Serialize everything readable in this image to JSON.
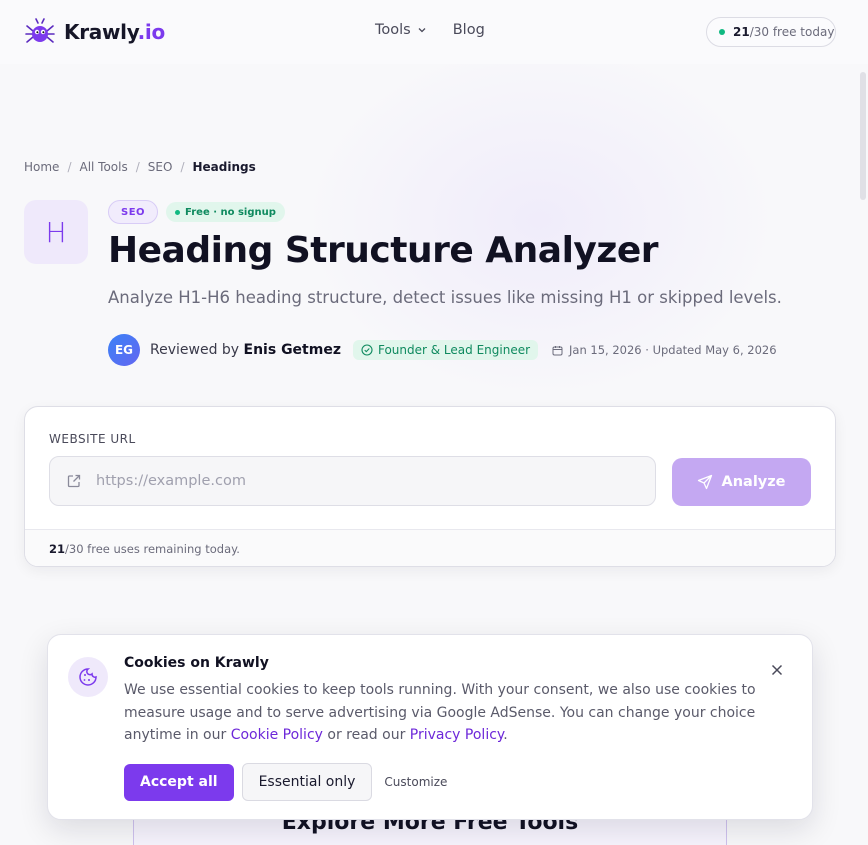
{
  "header": {
    "logo_text": "Krawly",
    "logo_suffix": ".io",
    "nav": [
      {
        "label": "Tools"
      },
      {
        "label": "Blog"
      }
    ],
    "usage": {
      "used": "21",
      "rest": "/30 free today"
    }
  },
  "breadcrumb": [
    "Home",
    "All Tools",
    "SEO",
    "Headings"
  ],
  "tool": {
    "icon_letter": "H",
    "badge_category": "SEO",
    "badge_free": "Free · no signup",
    "title": "Heading Structure Analyzer",
    "subtitle": "Analyze H1-H6 heading structure, detect issues like missing H1 or skipped levels."
  },
  "author": {
    "initials": "EG",
    "reviewed_prefix": "Reviewed by ",
    "name": "Enis Getmez",
    "role": "Founder & Lead Engineer",
    "dates": "Jan 15, 2026 · Updated May 6, 2026"
  },
  "form": {
    "label": "WEBSITE URL",
    "placeholder": "https://example.com",
    "button": "Analyze",
    "remaining_count": "21",
    "remaining_text": "/30 free uses remaining today."
  },
  "explore_title": "Explore More Free Tools",
  "cookie": {
    "title": "Cookies on Krawly",
    "text": "We use essential cookies to keep tools running. With your consent, we also use cookies to measure usage and to serve advertising via Google AdSense. You can change your choice anytime in our ",
    "cookie_link": "Cookie Policy",
    "middle": " or read our ",
    "privacy_link": "Privacy Policy",
    "end": ".",
    "accept": "Accept all",
    "essential": "Essential only",
    "customize": "Customize"
  },
  "colors": {
    "accent": "#7c3aed",
    "accent_light": "#c4a8f2",
    "success": "#10b981"
  },
  "icons": [
    "spider-logo-icon",
    "chevron-down-icon",
    "check-circle-icon",
    "calendar-icon",
    "external-link-icon",
    "send-icon",
    "cookie-icon",
    "close-icon"
  ]
}
